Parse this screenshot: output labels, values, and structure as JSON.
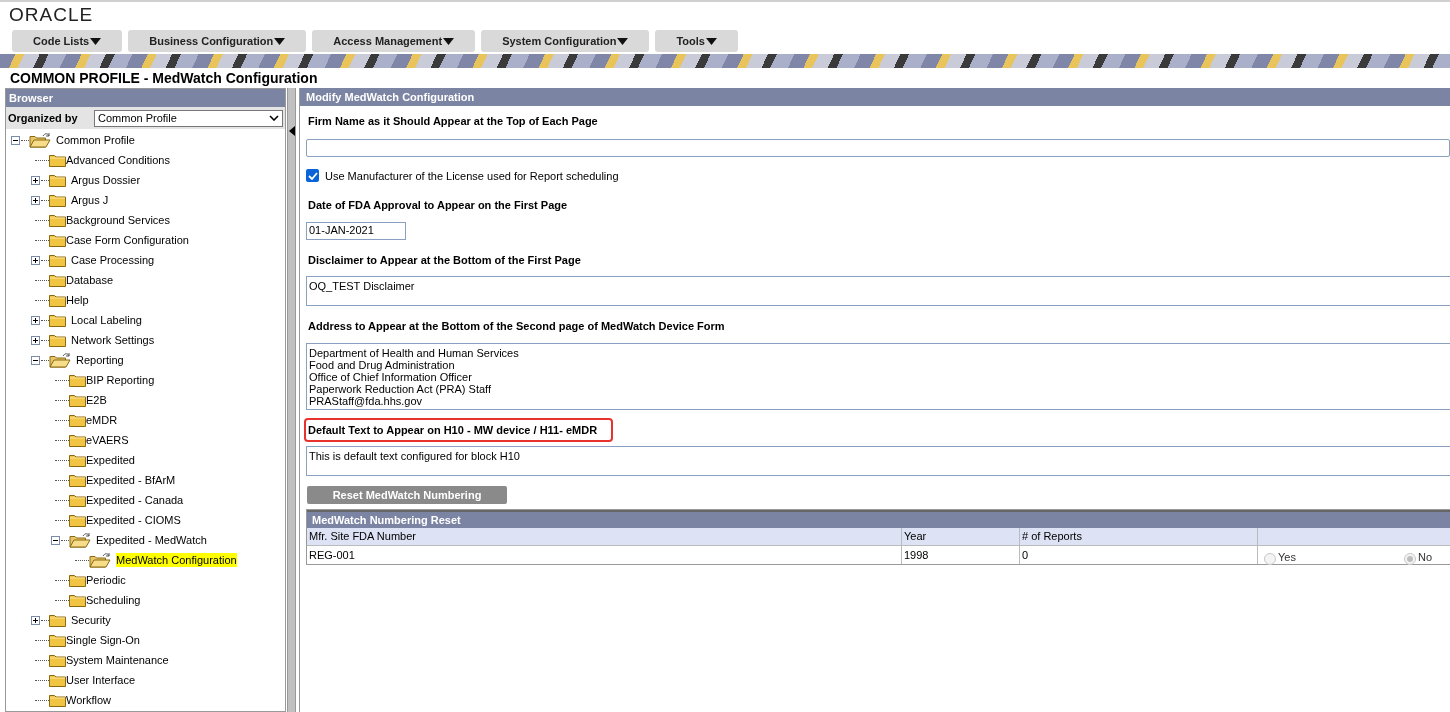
{
  "logo": "ORACLE",
  "menu": [
    {
      "label": "Code Lists"
    },
    {
      "label": "Business Configuration"
    },
    {
      "label": "Access Management"
    },
    {
      "label": "System Configuration"
    },
    {
      "label": "Tools"
    }
  ],
  "page_title": "COMMON PROFILE - MedWatch Configuration",
  "browser": {
    "title": "Browser",
    "organized_by_label": "Organized by",
    "organized_by_value": "Common Profile",
    "tree": [
      {
        "label": "Common Profile",
        "kind": "expanded",
        "selected": false,
        "children": [
          {
            "label": "Advanced Conditions",
            "kind": "folder",
            "selected": false
          },
          {
            "label": "Argus Dossier",
            "kind": "collapsed",
            "selected": false
          },
          {
            "label": "Argus J",
            "kind": "collapsed",
            "selected": false
          },
          {
            "label": "Background Services",
            "kind": "folder",
            "selected": false
          },
          {
            "label": "Case Form Configuration",
            "kind": "folder",
            "selected": false
          },
          {
            "label": "Case Processing",
            "kind": "collapsed",
            "selected": false
          },
          {
            "label": "Database",
            "kind": "folder",
            "selected": false
          },
          {
            "label": "Help",
            "kind": "folder",
            "selected": false
          },
          {
            "label": "Local Labeling",
            "kind": "collapsed",
            "selected": false
          },
          {
            "label": "Network Settings",
            "kind": "collapsed",
            "selected": false
          },
          {
            "label": "Reporting",
            "kind": "expanded",
            "selected": false,
            "children": [
              {
                "label": "BIP Reporting",
                "kind": "folder",
                "selected": false
              },
              {
                "label": "E2B",
                "kind": "folder",
                "selected": false
              },
              {
                "label": "eMDR",
                "kind": "folder",
                "selected": false
              },
              {
                "label": "eVAERS",
                "kind": "folder",
                "selected": false
              },
              {
                "label": "Expedited",
                "kind": "folder",
                "selected": false
              },
              {
                "label": "Expedited - BfArM",
                "kind": "folder",
                "selected": false
              },
              {
                "label": "Expedited - Canada",
                "kind": "folder",
                "selected": false
              },
              {
                "label": "Expedited - CIOMS",
                "kind": "folder",
                "selected": false
              },
              {
                "label": "Expedited - MedWatch",
                "kind": "expanded",
                "selected": false,
                "children": [
                  {
                    "label": "MedWatch Configuration",
                    "kind": "open",
                    "selected": true
                  }
                ]
              },
              {
                "label": "Periodic",
                "kind": "folder",
                "selected": false
              },
              {
                "label": "Scheduling",
                "kind": "folder",
                "selected": false
              }
            ]
          },
          {
            "label": "Security",
            "kind": "collapsed",
            "selected": false
          },
          {
            "label": "Single Sign-On",
            "kind": "folder",
            "selected": false
          },
          {
            "label": "System Maintenance",
            "kind": "folder",
            "selected": false
          },
          {
            "label": "User Interface",
            "kind": "folder",
            "selected": false
          },
          {
            "label": "Workflow",
            "kind": "folder",
            "selected": false
          }
        ]
      }
    ]
  },
  "main": {
    "title": "Modify MedWatch Configuration",
    "fields": [
      {
        "kind": "text",
        "label": "Firm Name as it Should Appear at the Top of Each Page",
        "highlighted": false
      },
      {
        "kind": "checkbox",
        "label": "Use Manufacturer of the License used for Report scheduling",
        "checked": true
      },
      {
        "kind": "date",
        "label": "Date of FDA Approval to Appear on the First Page",
        "value": "01-JAN-2021",
        "highlighted": false
      },
      {
        "kind": "textarea",
        "label": "Disclaimer to Appear at the Bottom of the First Page",
        "lines": [
          "OQ_TEST Disclaimer"
        ],
        "highlighted": false
      },
      {
        "kind": "textarea",
        "label": "Address to Appear at the Bottom of the Second page of MedWatch Device Form",
        "lines": [
          "Department of Health and Human Services",
          "Food and Drug Administration",
          "Office of Chief Information Officer",
          "Paperwork Reduction Act (PRA) Staff",
          "PRAStaff@fda.hhs.gov"
        ],
        "highlighted": false
      },
      {
        "kind": "textarea",
        "label": "Default Text to Appear on H10 - MW device / H11- eMDR",
        "lines": [
          "This is default text configured for block H10"
        ],
        "highlighted": true
      }
    ],
    "reset_button": "Reset MedWatch Numbering",
    "table": {
      "title": "MedWatch Numbering Reset",
      "columns": [
        "Mfr. Site FDA Number",
        "Year",
        "# of Reports"
      ],
      "rows": [
        {
          "cells": [
            "REG-001",
            "1998",
            "0"
          ],
          "options": [
            {
              "label": "Yes",
              "selected": false
            },
            {
              "label": "No",
              "selected": true
            }
          ]
        }
      ]
    }
  }
}
